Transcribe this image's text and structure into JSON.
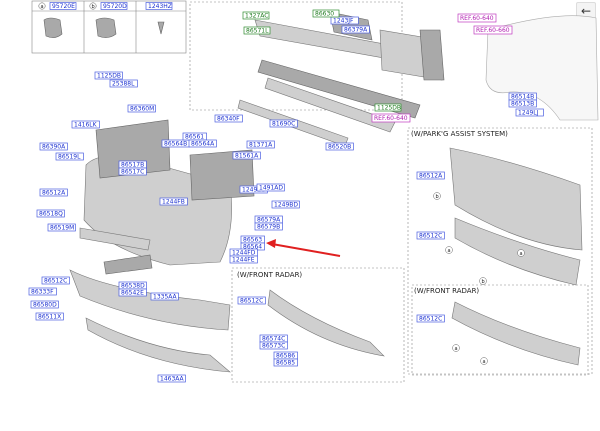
{
  "back_icon": "arrow-left-icon",
  "kit_labels": [
    "95720E",
    "95720D",
    "1243HZ"
  ],
  "kit_letters": [
    "a",
    "b"
  ],
  "labels": {
    "p1327AC": "1327AC",
    "p86630": "86630",
    "p86571L": "86571L",
    "p1243JF": "1243JF",
    "p86379A": "86379A",
    "p1125DB_a": "1125DB",
    "p1125DB_b": "1125DB",
    "p25388L": "25388L",
    "p86360M": "86360M",
    "p1416LK": "1416LK",
    "p86340F": "86340F",
    "p81690C": "81690C",
    "p86390A": "86390A",
    "p86519L": "86519L",
    "p86517B": "86517B",
    "p86517C": "86517C",
    "p86564B": "86564B",
    "p86561": "86561",
    "p86564A": "86564A",
    "p81371A": "81371A",
    "p81561A": "81561A",
    "p86520B": "86520B",
    "p86512A": "86512A",
    "p1249LG": "1249LG",
    "p1491AD": "1491AD",
    "p1244FB": "1244FB",
    "p1249BD": "1249BD",
    "p86518Q": "86518Q",
    "p86519M": "86519M",
    "p86579A": "86579A",
    "p86579B": "86579B",
    "p86563": "86563",
    "p86564": "86564",
    "p1244FD": "1244FD",
    "p1244FE": "1244FE",
    "p86512C": "86512C",
    "p86333F": "86333F",
    "p86580D": "86580D",
    "p86511X": "86511X",
    "p86538D": "86538D",
    "p86542E": "86542E",
    "p1335AA": "1335AA",
    "p1463AA": "1463AA",
    "p1249LJ": "1249LJ",
    "p86514B": "86514B",
    "p86513B": "86513B",
    "p86512C_fr": "86512C",
    "p86574C": "86574C",
    "p86573C": "86573C",
    "p86586": "86586",
    "p86585": "86585",
    "p86512A_pa": "86512A",
    "p86512C_pa": "86512C",
    "p86512C_pa2": "86512C"
  },
  "refs": [
    "REF.60-640",
    "REF.60-660",
    "REF.60-640"
  ],
  "subtitles": {
    "front_radar": "(W/FRONT RADAR)",
    "park_assist": "(W/PARK'G ASSIST SYSTEM)",
    "front_radar_2": "(W/FRONT RADAR)"
  },
  "callouts": [
    "b",
    "a",
    "a",
    "a",
    "b",
    "a"
  ],
  "colors": {
    "label": "#1a2fd0",
    "highlight_arrow": "#e02020",
    "ref": "#b01cb0",
    "green_tag": "#1e7a1e"
  }
}
